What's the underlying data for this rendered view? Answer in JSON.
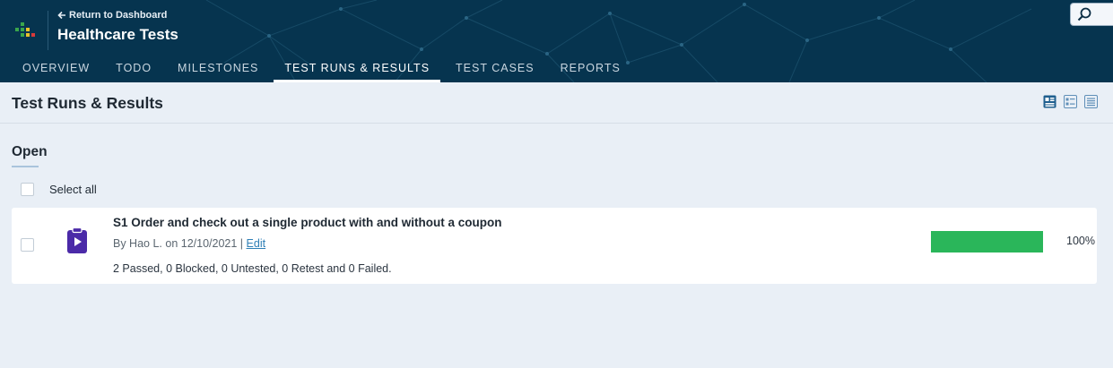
{
  "header": {
    "return_label": "Return to Dashboard",
    "project_title": "Healthcare Tests",
    "background_color": "#06344f"
  },
  "tabs": [
    {
      "label": "OVERVIEW",
      "active": false
    },
    {
      "label": "TODO",
      "active": false
    },
    {
      "label": "MILESTONES",
      "active": false
    },
    {
      "label": "TEST RUNS & RESULTS",
      "active": true
    },
    {
      "label": "TEST CASES",
      "active": false
    },
    {
      "label": "REPORTS",
      "active": false
    }
  ],
  "page": {
    "title": "Test Runs & Results",
    "view_icons": [
      "detailed-view-icon",
      "compact-view-icon",
      "list-view-icon"
    ]
  },
  "section": {
    "title": "Open",
    "select_all_label": "Select all"
  },
  "runs": [
    {
      "title": "S1 Order and check out a single product with and without a coupon",
      "author_date": "By Hao L. on 12/10/2021",
      "separator": "|",
      "edit_label": "Edit",
      "summary": "2 Passed, 0 Blocked, 0 Untested, 0 Retest and 0 Failed.",
      "progress_percent": 100,
      "progress_label": "100%",
      "progress_color": "#2ab65a",
      "icon": "test-run-clipboard-icon",
      "icon_color": "#4b2aa8"
    }
  ]
}
